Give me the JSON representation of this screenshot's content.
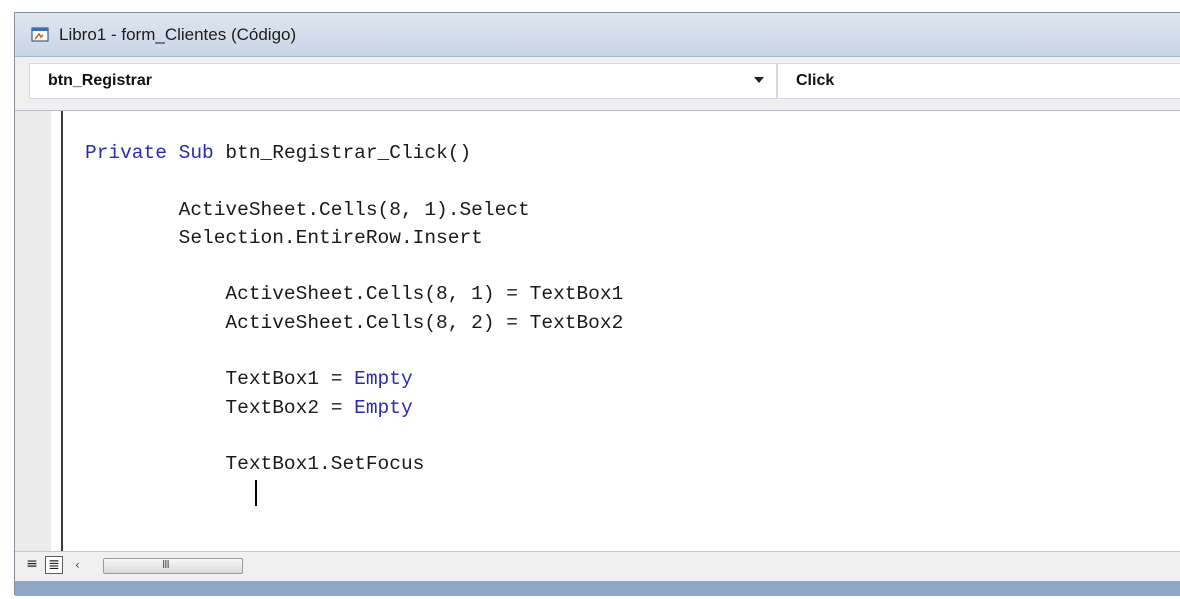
{
  "window": {
    "title": "Libro1 - form_Clientes (Código)",
    "icon": "form-code-icon"
  },
  "object_combo": {
    "value": "btn_Registrar"
  },
  "procedure_combo": {
    "value": "Click"
  },
  "code": {
    "lines": [
      "Private Sub btn_Registrar_Click()",
      "",
      "        ActiveSheet.Cells(8, 1).Select",
      "        Selection.EntireRow.Insert",
      "",
      "            ActiveSheet.Cells(8, 1) = TextBox1",
      "            ActiveSheet.Cells(8, 2) = TextBox2",
      "",
      "            TextBox1 = Empty",
      "            TextBox2 = Empty",
      "",
      "            TextBox1.SetFocus"
    ],
    "keywords": [
      "Private",
      "Sub",
      "Empty"
    ],
    "keyword_color": "#2a2ab2"
  },
  "statusbar": {
    "procedure_view_icon": "procedure-view-icon",
    "full_module_view_icon": "full-module-view-icon",
    "scroll_left_glyph": "‹",
    "thumb_grip": "III"
  }
}
